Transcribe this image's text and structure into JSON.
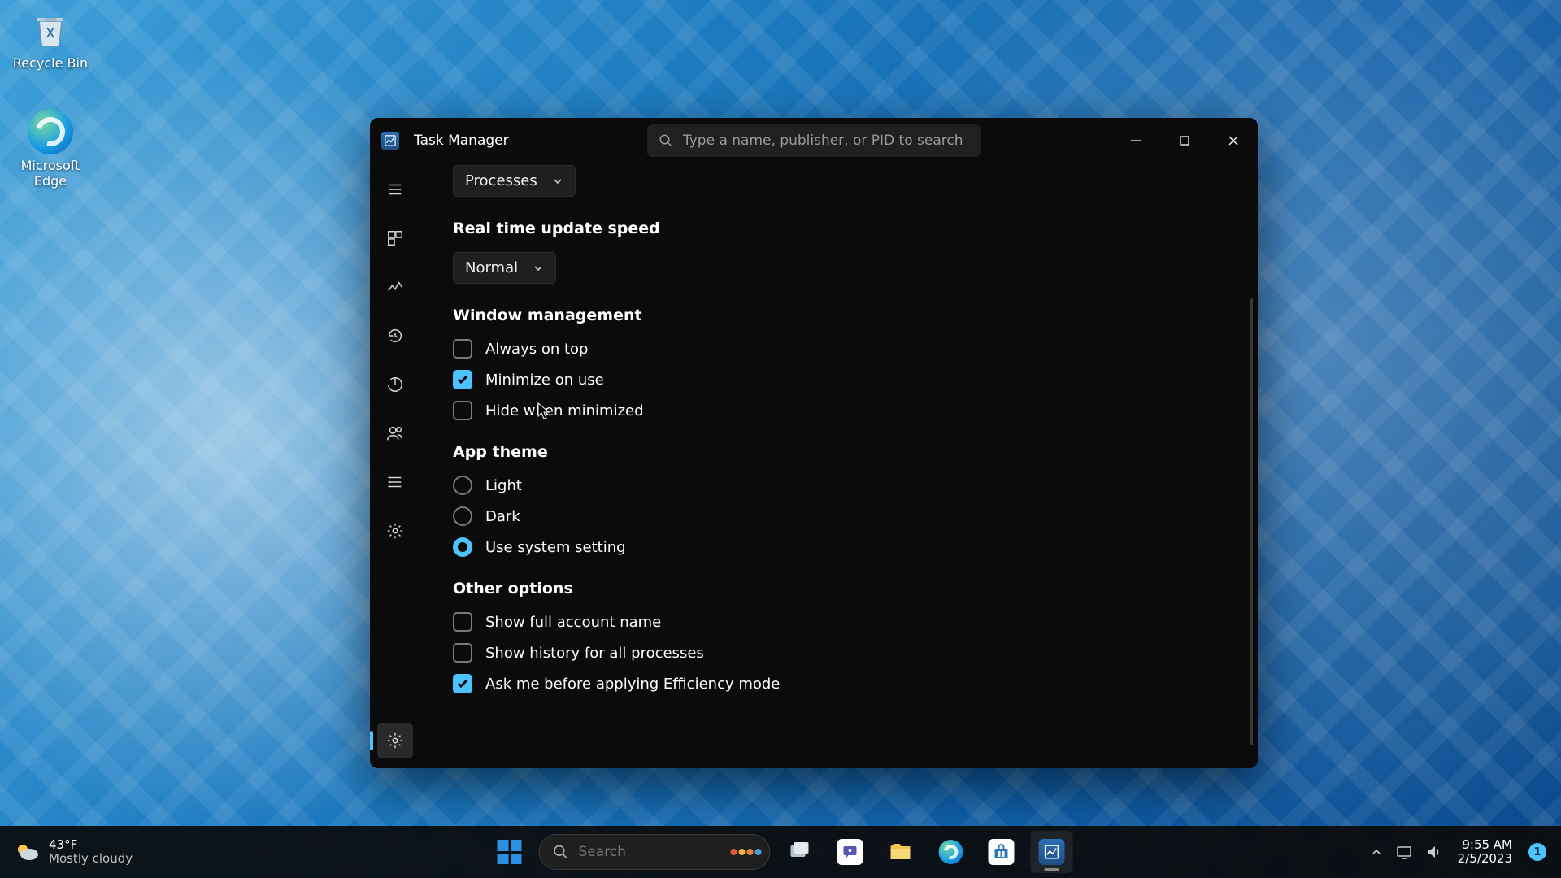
{
  "desktop": {
    "icons": [
      {
        "name": "recycle-bin",
        "label": "Recycle Bin"
      },
      {
        "name": "microsoft-edge",
        "label": "Microsoft Edge"
      }
    ]
  },
  "window": {
    "title": "Task Manager",
    "search_placeholder": "Type a name, publisher, or PID to search",
    "sidebar": {
      "items": [
        {
          "name": "hamburger",
          "icon": "menu"
        },
        {
          "name": "processes",
          "icon": "processes"
        },
        {
          "name": "performance",
          "icon": "performance"
        },
        {
          "name": "app-history",
          "icon": "history"
        },
        {
          "name": "startup-apps",
          "icon": "startup"
        },
        {
          "name": "users",
          "icon": "users"
        },
        {
          "name": "details",
          "icon": "details"
        },
        {
          "name": "services",
          "icon": "services"
        }
      ],
      "footer": {
        "name": "settings",
        "icon": "settings",
        "active": true
      }
    },
    "settings": {
      "default_page": {
        "label": "Processes"
      },
      "update_speed": {
        "title": "Real time update speed",
        "value": "Normal"
      },
      "window_management": {
        "title": "Window management",
        "options": [
          {
            "label": "Always on top",
            "checked": false
          },
          {
            "label": "Minimize on use",
            "checked": true
          },
          {
            "label": "Hide when minimized",
            "checked": false
          }
        ]
      },
      "app_theme": {
        "title": "App theme",
        "options": [
          {
            "label": "Light",
            "selected": false
          },
          {
            "label": "Dark",
            "selected": false
          },
          {
            "label": "Use system setting",
            "selected": true
          }
        ]
      },
      "other": {
        "title": "Other options",
        "options": [
          {
            "label": "Show full account name",
            "checked": false
          },
          {
            "label": "Show history for all processes",
            "checked": false
          },
          {
            "label": "Ask me before applying Efficiency mode",
            "checked": true
          }
        ]
      }
    }
  },
  "taskbar": {
    "weather": {
      "temp": "43°F",
      "desc": "Mostly cloudy"
    },
    "search_placeholder": "Search",
    "pinned": [
      {
        "name": "start"
      },
      {
        "name": "search"
      },
      {
        "name": "task-view"
      },
      {
        "name": "chat"
      },
      {
        "name": "file-explorer"
      },
      {
        "name": "edge"
      },
      {
        "name": "microsoft-store"
      },
      {
        "name": "task-manager",
        "active": true
      }
    ],
    "clock": {
      "time": "9:55 AM",
      "date": "2/5/2023"
    },
    "notification_count": "1"
  }
}
